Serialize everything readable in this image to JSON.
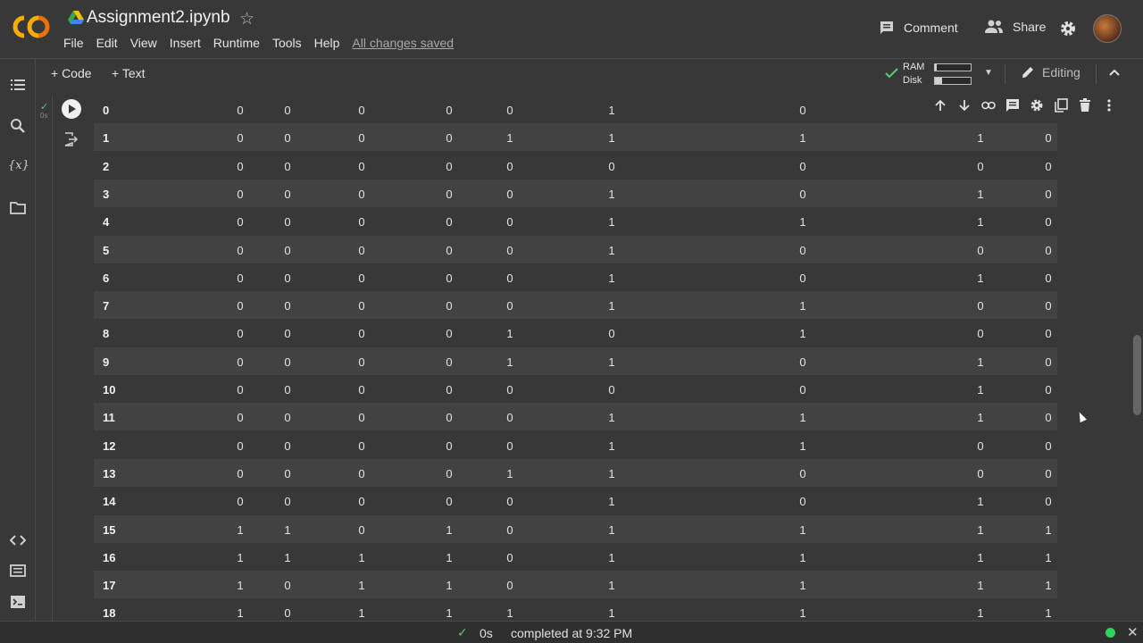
{
  "app": {
    "title": "Assignment2.ipynb",
    "menu": [
      "File",
      "Edit",
      "View",
      "Insert",
      "Runtime",
      "Tools",
      "Help"
    ],
    "save_status": "All changes saved",
    "comment_label": "Comment",
    "share_label": "Share"
  },
  "toolbar": {
    "add_code": "+ Code",
    "add_text": "+ Text",
    "ram_label": "RAM",
    "disk_label": "Disk",
    "ram_usage": 0.05,
    "disk_usage": 0.2,
    "editing_label": "Editing"
  },
  "cell": {
    "status": "✓",
    "duration_small": "0s"
  },
  "table": {
    "rows": [
      {
        "idx": "0",
        "vals": [
          "0",
          "0",
          "0",
          "0",
          "0",
          "1",
          "0",
          "",
          ""
        ]
      },
      {
        "idx": "1",
        "vals": [
          "0",
          "0",
          "0",
          "0",
          "1",
          "1",
          "1",
          "1",
          "0"
        ]
      },
      {
        "idx": "2",
        "vals": [
          "0",
          "0",
          "0",
          "0",
          "0",
          "0",
          "0",
          "0",
          "0"
        ]
      },
      {
        "idx": "3",
        "vals": [
          "0",
          "0",
          "0",
          "0",
          "0",
          "1",
          "0",
          "1",
          "0"
        ]
      },
      {
        "idx": "4",
        "vals": [
          "0",
          "0",
          "0",
          "0",
          "0",
          "1",
          "1",
          "1",
          "0"
        ]
      },
      {
        "idx": "5",
        "vals": [
          "0",
          "0",
          "0",
          "0",
          "0",
          "1",
          "0",
          "0",
          "0"
        ]
      },
      {
        "idx": "6",
        "vals": [
          "0",
          "0",
          "0",
          "0",
          "0",
          "1",
          "0",
          "1",
          "0"
        ]
      },
      {
        "idx": "7",
        "vals": [
          "0",
          "0",
          "0",
          "0",
          "0",
          "1",
          "1",
          "0",
          "0"
        ]
      },
      {
        "idx": "8",
        "vals": [
          "0",
          "0",
          "0",
          "0",
          "1",
          "0",
          "1",
          "0",
          "0"
        ]
      },
      {
        "idx": "9",
        "vals": [
          "0",
          "0",
          "0",
          "0",
          "1",
          "1",
          "0",
          "1",
          "0"
        ]
      },
      {
        "idx": "10",
        "vals": [
          "0",
          "0",
          "0",
          "0",
          "0",
          "0",
          "0",
          "1",
          "0"
        ]
      },
      {
        "idx": "11",
        "vals": [
          "0",
          "0",
          "0",
          "0",
          "0",
          "1",
          "1",
          "1",
          "0"
        ]
      },
      {
        "idx": "12",
        "vals": [
          "0",
          "0",
          "0",
          "0",
          "0",
          "1",
          "1",
          "0",
          "0"
        ]
      },
      {
        "idx": "13",
        "vals": [
          "0",
          "0",
          "0",
          "0",
          "1",
          "1",
          "0",
          "0",
          "0"
        ]
      },
      {
        "idx": "14",
        "vals": [
          "0",
          "0",
          "0",
          "0",
          "0",
          "1",
          "0",
          "1",
          "0"
        ]
      },
      {
        "idx": "15",
        "vals": [
          "1",
          "1",
          "0",
          "1",
          "0",
          "1",
          "1",
          "1",
          "1"
        ]
      },
      {
        "idx": "16",
        "vals": [
          "1",
          "1",
          "1",
          "1",
          "0",
          "1",
          "1",
          "1",
          "1"
        ]
      },
      {
        "idx": "17",
        "vals": [
          "1",
          "0",
          "1",
          "1",
          "0",
          "1",
          "1",
          "1",
          "1"
        ]
      },
      {
        "idx": "18",
        "vals": [
          "1",
          "0",
          "1",
          "1",
          "1",
          "1",
          "1",
          "1",
          "1"
        ]
      }
    ]
  },
  "status_bar": {
    "check": "✓",
    "duration": "0s",
    "message": "completed at 9:32 PM"
  },
  "colors": {
    "background": "#383838",
    "row_alt": "#424242",
    "success": "#5ec776",
    "connected": "#2fd45c"
  },
  "icons": [
    "colab-logo",
    "drive-icon",
    "star-icon",
    "comment-icon",
    "share-icon",
    "gear-icon",
    "toc-icon",
    "search-icon",
    "variables-icon",
    "folder-icon",
    "code-snippets-icon",
    "command-palette-icon",
    "terminal-icon",
    "pencil-icon",
    "chevron-up-icon",
    "arrow-up-icon",
    "arrow-down-icon",
    "link-icon",
    "comment-icon",
    "copy-icon",
    "trash-icon",
    "more-vert-icon",
    "play-icon",
    "output-icon",
    "close-icon"
  ]
}
